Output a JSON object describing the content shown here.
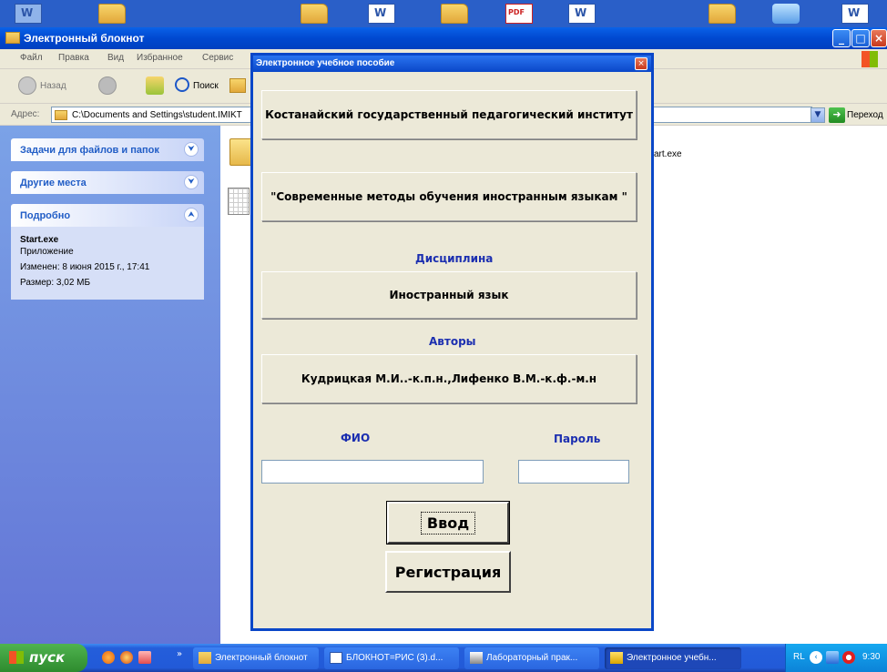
{
  "explorer": {
    "title": "Электронный блокнот",
    "menu": [
      "Файл",
      "Правка",
      "Вид",
      "Избранное",
      "Сервис"
    ],
    "toolbar": {
      "back": "Назад",
      "search": "Поиск"
    },
    "address": {
      "label": "Адрес:",
      "value": "C:\\Documents and Settings\\student.IMIKT",
      "go": "Переход"
    },
    "taskpane": {
      "tasks_header": "Задачи для файлов и папок",
      "other_header": "Другие места",
      "details_header": "Подробно",
      "details": {
        "name": "Start.exe",
        "type": "Приложение",
        "modified": "Изменен: 8 июня 2015 г., 17:41",
        "size": "Размер: 3,02 МБ"
      }
    },
    "file_label": "art.exe"
  },
  "dialog": {
    "title": "Электронное учебное пособие",
    "institute": "Костанайский государственный педагогический институт",
    "course": "\"Современные методы обучения иностранным языкам \"",
    "discipline_label": "Дисциплина",
    "discipline": "Иностранный язык",
    "authors_label": "Авторы",
    "authors": "Кудрицкая М.И..-к.п.н.,Лифенко В.М.-к.ф.-м.н",
    "fio_label": "ФИО",
    "password_label": "Пароль",
    "fio_value": "",
    "password_value": "",
    "enter_button": "Ввод",
    "register_button": "Регистрация"
  },
  "taskbar": {
    "start": "пуск",
    "tasks": [
      {
        "label": "Электронный блокнот",
        "icon": "folder-icon"
      },
      {
        "label": "БЛОКНОТ=РИС (3).d...",
        "icon": "word-icon"
      },
      {
        "label": "Лабораторный прак...",
        "icon": "app-icon"
      },
      {
        "label": "Электронное учебн...",
        "icon": "delphi-icon"
      }
    ],
    "lang": "RL",
    "clock": "9:30"
  }
}
